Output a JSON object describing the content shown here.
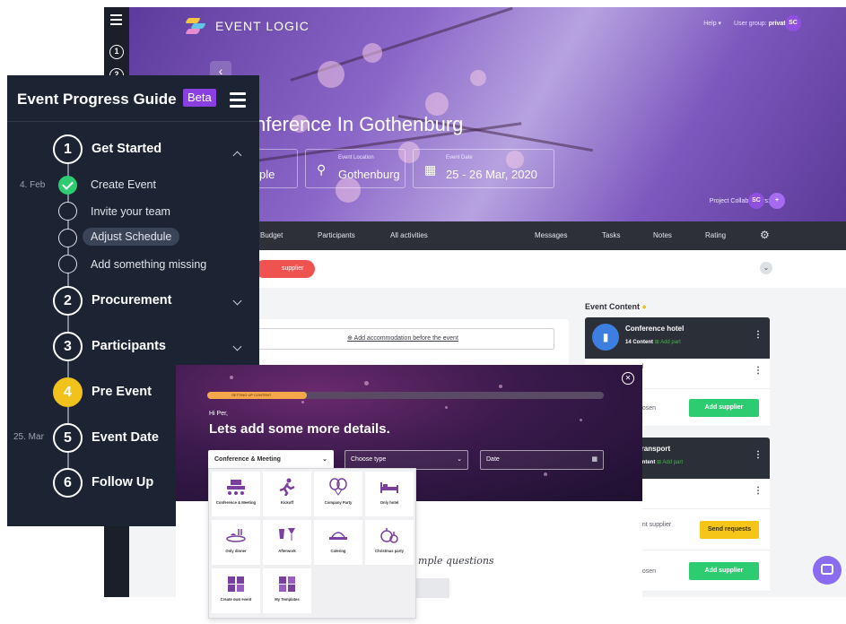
{
  "app": {
    "brand": "EVENT LOGIC",
    "top_right": {
      "help": "Help ▾",
      "user_group_prefix": "User group:",
      "user_group_value": "private ▾",
      "user_initials": "SC"
    },
    "event_title": "nference In Gothenburg",
    "info_boxes": [
      {
        "small": "",
        "big": "ple"
      },
      {
        "small": "Event Location",
        "big": "Gothenburg"
      },
      {
        "small": "Event Date",
        "big": "25 - 26 Mar, 2020"
      }
    ],
    "collaborators": {
      "label": "Project Collaborators:",
      "initials": "SC",
      "add": "+"
    },
    "nav": [
      "Budget",
      "Participants",
      "All activities",
      "Messages",
      "Tasks",
      "Notes",
      "Rating"
    ],
    "supplier_pill": "supplier",
    "accommodation_link": "Add accommodation before the event",
    "event_content_title": "Event Content",
    "cards": [
      {
        "title": "Conference hotel",
        "count": "14 Content",
        "add": "Add part"
      },
      {
        "title": "transport",
        "count": "ontent",
        "add": "Add part"
      }
    ],
    "rows": [
      {
        "label": "el"
      },
      {
        "label": "hosen",
        "button": "Add supplier"
      },
      {
        "label": ""
      },
      {
        "label": "ent supplier",
        "button": "Send requests"
      },
      {
        "label": "hosen",
        "button": "Add supplier"
      }
    ]
  },
  "guide": {
    "title": "Event Progress Guide",
    "badge": "Beta",
    "steps": [
      {
        "num": "1",
        "label": "Get Started",
        "date": ""
      },
      {
        "num": "2",
        "label": "Procurement",
        "date": ""
      },
      {
        "num": "3",
        "label": "Participants",
        "date": ""
      },
      {
        "num": "4",
        "label": "Pre Event",
        "date": ""
      },
      {
        "num": "5",
        "label": "Event Date",
        "date": "25. Mar"
      },
      {
        "num": "6",
        "label": "Follow Up",
        "date": ""
      }
    ],
    "substeps": [
      {
        "label": "Create Event",
        "date": "4. Feb",
        "done": true
      },
      {
        "label": "Invite your team",
        "done": false
      },
      {
        "label": "Adjust Schedule",
        "done": false
      },
      {
        "label": "Add something missing",
        "done": false
      }
    ]
  },
  "modal": {
    "progress_label": "SETTING UP CONTENT",
    "progress": 0.25,
    "greeting": "Hi Per,",
    "headline": "Lets add some more details.",
    "fields": {
      "type": "Conference & Meeting",
      "subtype": "Choose type",
      "date": "Date"
    },
    "questions_text": "mple questions",
    "event_types": [
      "Conference & Meeting",
      "Kickoff",
      "Company Party",
      "Only hotel",
      "Only dinner",
      "Afterwork",
      "Catering",
      "Christmas party",
      "Create own event",
      "My Templates"
    ]
  },
  "colors": {
    "accent": "#8a3fe0",
    "active_step": "#f2c21c",
    "done": "#2ecc71",
    "alert": "#ef5350"
  }
}
